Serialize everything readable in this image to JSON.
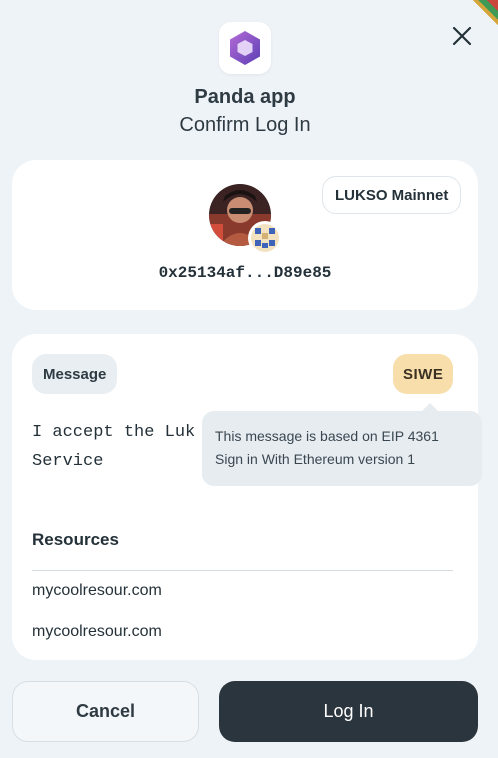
{
  "app": {
    "name": "Panda app",
    "subtitle": "Confirm Log In"
  },
  "account": {
    "network": "LUKSO Mainnet",
    "address": "0x25134af...D89e85"
  },
  "message": {
    "tag": "Message",
    "type_badge": "SIWE",
    "text_line1": "I accept the Luk",
    "text_line2": "Service",
    "resources_title": "Resources",
    "resources": [
      "mycoolresour.com",
      "mycoolresour.com"
    ]
  },
  "tooltip": {
    "line1": "This message is based on EIP 4361",
    "line2": "Sign in With Ethereum version 1"
  },
  "actions": {
    "cancel_label": "Cancel",
    "login_label": "Log In"
  },
  "colors": {
    "background": "#eef3f7",
    "primary_button": "#2b353d",
    "siwe_badge": "#f7deaa",
    "logo_accent": "#7b4fc4"
  }
}
